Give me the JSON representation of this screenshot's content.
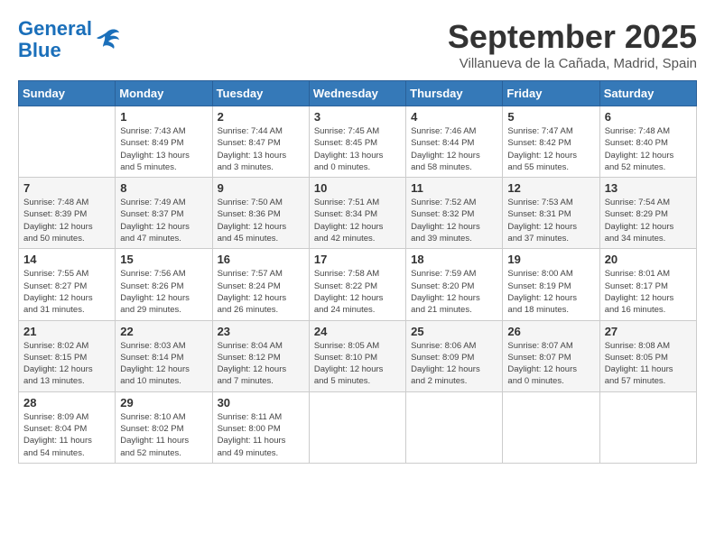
{
  "logo": {
    "line1": "General",
    "line2": "Blue"
  },
  "title": "September 2025",
  "subtitle": "Villanueva de la Cañada, Madrid, Spain",
  "days_of_week": [
    "Sunday",
    "Monday",
    "Tuesday",
    "Wednesday",
    "Thursday",
    "Friday",
    "Saturday"
  ],
  "weeks": [
    [
      {
        "day": "",
        "info": ""
      },
      {
        "day": "1",
        "info": "Sunrise: 7:43 AM\nSunset: 8:49 PM\nDaylight: 13 hours\nand 5 minutes."
      },
      {
        "day": "2",
        "info": "Sunrise: 7:44 AM\nSunset: 8:47 PM\nDaylight: 13 hours\nand 3 minutes."
      },
      {
        "day": "3",
        "info": "Sunrise: 7:45 AM\nSunset: 8:45 PM\nDaylight: 13 hours\nand 0 minutes."
      },
      {
        "day": "4",
        "info": "Sunrise: 7:46 AM\nSunset: 8:44 PM\nDaylight: 12 hours\nand 58 minutes."
      },
      {
        "day": "5",
        "info": "Sunrise: 7:47 AM\nSunset: 8:42 PM\nDaylight: 12 hours\nand 55 minutes."
      },
      {
        "day": "6",
        "info": "Sunrise: 7:48 AM\nSunset: 8:40 PM\nDaylight: 12 hours\nand 52 minutes."
      }
    ],
    [
      {
        "day": "7",
        "info": "Sunrise: 7:48 AM\nSunset: 8:39 PM\nDaylight: 12 hours\nand 50 minutes."
      },
      {
        "day": "8",
        "info": "Sunrise: 7:49 AM\nSunset: 8:37 PM\nDaylight: 12 hours\nand 47 minutes."
      },
      {
        "day": "9",
        "info": "Sunrise: 7:50 AM\nSunset: 8:36 PM\nDaylight: 12 hours\nand 45 minutes."
      },
      {
        "day": "10",
        "info": "Sunrise: 7:51 AM\nSunset: 8:34 PM\nDaylight: 12 hours\nand 42 minutes."
      },
      {
        "day": "11",
        "info": "Sunrise: 7:52 AM\nSunset: 8:32 PM\nDaylight: 12 hours\nand 39 minutes."
      },
      {
        "day": "12",
        "info": "Sunrise: 7:53 AM\nSunset: 8:31 PM\nDaylight: 12 hours\nand 37 minutes."
      },
      {
        "day": "13",
        "info": "Sunrise: 7:54 AM\nSunset: 8:29 PM\nDaylight: 12 hours\nand 34 minutes."
      }
    ],
    [
      {
        "day": "14",
        "info": "Sunrise: 7:55 AM\nSunset: 8:27 PM\nDaylight: 12 hours\nand 31 minutes."
      },
      {
        "day": "15",
        "info": "Sunrise: 7:56 AM\nSunset: 8:26 PM\nDaylight: 12 hours\nand 29 minutes."
      },
      {
        "day": "16",
        "info": "Sunrise: 7:57 AM\nSunset: 8:24 PM\nDaylight: 12 hours\nand 26 minutes."
      },
      {
        "day": "17",
        "info": "Sunrise: 7:58 AM\nSunset: 8:22 PM\nDaylight: 12 hours\nand 24 minutes."
      },
      {
        "day": "18",
        "info": "Sunrise: 7:59 AM\nSunset: 8:20 PM\nDaylight: 12 hours\nand 21 minutes."
      },
      {
        "day": "19",
        "info": "Sunrise: 8:00 AM\nSunset: 8:19 PM\nDaylight: 12 hours\nand 18 minutes."
      },
      {
        "day": "20",
        "info": "Sunrise: 8:01 AM\nSunset: 8:17 PM\nDaylight: 12 hours\nand 16 minutes."
      }
    ],
    [
      {
        "day": "21",
        "info": "Sunrise: 8:02 AM\nSunset: 8:15 PM\nDaylight: 12 hours\nand 13 minutes."
      },
      {
        "day": "22",
        "info": "Sunrise: 8:03 AM\nSunset: 8:14 PM\nDaylight: 12 hours\nand 10 minutes."
      },
      {
        "day": "23",
        "info": "Sunrise: 8:04 AM\nSunset: 8:12 PM\nDaylight: 12 hours\nand 7 minutes."
      },
      {
        "day": "24",
        "info": "Sunrise: 8:05 AM\nSunset: 8:10 PM\nDaylight: 12 hours\nand 5 minutes."
      },
      {
        "day": "25",
        "info": "Sunrise: 8:06 AM\nSunset: 8:09 PM\nDaylight: 12 hours\nand 2 minutes."
      },
      {
        "day": "26",
        "info": "Sunrise: 8:07 AM\nSunset: 8:07 PM\nDaylight: 12 hours\nand 0 minutes."
      },
      {
        "day": "27",
        "info": "Sunrise: 8:08 AM\nSunset: 8:05 PM\nDaylight: 11 hours\nand 57 minutes."
      }
    ],
    [
      {
        "day": "28",
        "info": "Sunrise: 8:09 AM\nSunset: 8:04 PM\nDaylight: 11 hours\nand 54 minutes."
      },
      {
        "day": "29",
        "info": "Sunrise: 8:10 AM\nSunset: 8:02 PM\nDaylight: 11 hours\nand 52 minutes."
      },
      {
        "day": "30",
        "info": "Sunrise: 8:11 AM\nSunset: 8:00 PM\nDaylight: 11 hours\nand 49 minutes."
      },
      {
        "day": "",
        "info": ""
      },
      {
        "day": "",
        "info": ""
      },
      {
        "day": "",
        "info": ""
      },
      {
        "day": "",
        "info": ""
      }
    ]
  ]
}
